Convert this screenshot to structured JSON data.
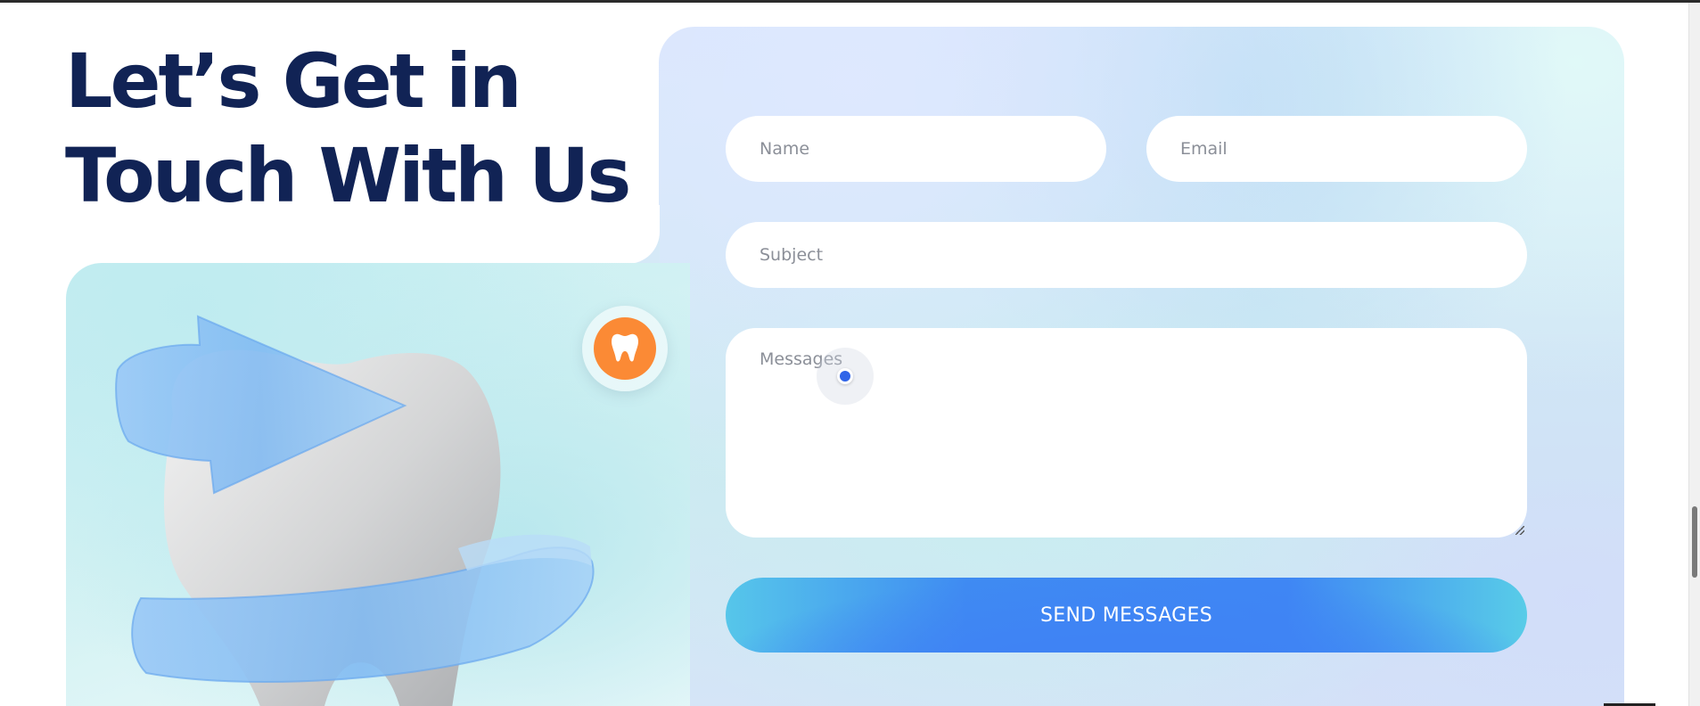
{
  "heading": {
    "line1": "Let’s Get in",
    "line2": "Touch With Us"
  },
  "form": {
    "name_placeholder": "Name",
    "email_placeholder": "Email",
    "subject_placeholder": "Subject",
    "message_placeholder": "Messages",
    "submit_label": "SEND MESSAGES"
  },
  "icons": {
    "badge": "tooth-icon",
    "illustration": "tooth-with-arrow-illustration"
  },
  "colors": {
    "heading": "#112355",
    "badge": "#fb8a35",
    "button_start": "#56c6ea",
    "button_mid": "#3f86f4",
    "cursor_dot": "#2f64e8"
  }
}
